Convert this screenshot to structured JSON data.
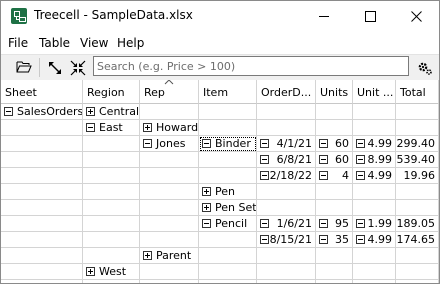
{
  "window": {
    "title": "Treecell - SampleData.xlsx"
  },
  "menu": {
    "items": [
      "File",
      "Table",
      "View",
      "Help"
    ]
  },
  "toolbar": {
    "open_icon": "folder-open-icon",
    "expand_icon": "expand-all-icon",
    "collapse_icon": "collapse-all-icon",
    "search_placeholder": "Search (e.g. Price > 100)",
    "search_value": "",
    "settings_icon": "gear-icon"
  },
  "table": {
    "columns": [
      "Sheet",
      "Region",
      "Rep",
      "Item",
      "OrderD...",
      "Units",
      "Unit ...",
      "Total"
    ],
    "sorted_column": "Rep",
    "rows": [
      {
        "sheet": "SalesOrders",
        "sheet_node": "collapse",
        "region": "Central",
        "region_node": "expand",
        "rep": "",
        "rep_node": "",
        "item": "",
        "item_node": "",
        "date": "",
        "units": "",
        "unit_cost": "",
        "total": ""
      },
      {
        "sheet": "",
        "sheet_node": "",
        "region": "East",
        "region_node": "collapse",
        "rep": "Howard",
        "rep_node": "expand",
        "item": "",
        "item_node": "",
        "date": "",
        "units": "",
        "unit_cost": "",
        "total": ""
      },
      {
        "sheet": "",
        "sheet_node": "",
        "region": "",
        "region_node": "",
        "rep": "Jones",
        "rep_node": "collapse",
        "item": "Binder",
        "item_node": "collapse",
        "date": "4/1/21",
        "units": "60",
        "unit_cost": "4.99",
        "total": "299.40"
      },
      {
        "sheet": "",
        "sheet_node": "",
        "region": "",
        "region_node": "",
        "rep": "",
        "rep_node": "",
        "item": "",
        "item_node": "",
        "date": "6/8/21",
        "units": "60",
        "unit_cost": "8.99",
        "total": "539.40"
      },
      {
        "sheet": "",
        "sheet_node": "",
        "region": "",
        "region_node": "",
        "rep": "",
        "rep_node": "",
        "item": "",
        "item_node": "",
        "date": "2/18/22",
        "units": "4",
        "unit_cost": "4.99",
        "total": "19.96"
      },
      {
        "sheet": "",
        "sheet_node": "",
        "region": "",
        "region_node": "",
        "rep": "",
        "rep_node": "",
        "item": "Pen",
        "item_node": "expand",
        "date": "",
        "units": "",
        "unit_cost": "",
        "total": ""
      },
      {
        "sheet": "",
        "sheet_node": "",
        "region": "",
        "region_node": "",
        "rep": "",
        "rep_node": "",
        "item": "Pen Set",
        "item_node": "expand",
        "date": "",
        "units": "",
        "unit_cost": "",
        "total": ""
      },
      {
        "sheet": "",
        "sheet_node": "",
        "region": "",
        "region_node": "",
        "rep": "",
        "rep_node": "",
        "item": "Pencil",
        "item_node": "collapse",
        "date": "1/6/21",
        "units": "95",
        "unit_cost": "1.99",
        "total": "189.05"
      },
      {
        "sheet": "",
        "sheet_node": "",
        "region": "",
        "region_node": "",
        "rep": "",
        "rep_node": "",
        "item": "",
        "item_node": "",
        "date": "8/15/21",
        "units": "35",
        "unit_cost": "4.99",
        "total": "174.65"
      },
      {
        "sheet": "",
        "sheet_node": "",
        "region": "",
        "region_node": "",
        "rep": "Parent",
        "rep_node": "expand",
        "item": "",
        "item_node": "",
        "date": "",
        "units": "",
        "unit_cost": "",
        "total": ""
      },
      {
        "sheet": "",
        "sheet_node": "",
        "region": "West",
        "region_node": "expand",
        "rep": "",
        "rep_node": "",
        "item": "",
        "item_node": "",
        "date": "",
        "units": "",
        "unit_cost": "",
        "total": ""
      },
      {
        "sheet": "",
        "sheet_node": "",
        "region": "",
        "region_node": "",
        "rep": "",
        "rep_node": "",
        "item": "",
        "item_node": "",
        "date": "",
        "units": "",
        "unit_cost": "",
        "total": ""
      }
    ]
  }
}
